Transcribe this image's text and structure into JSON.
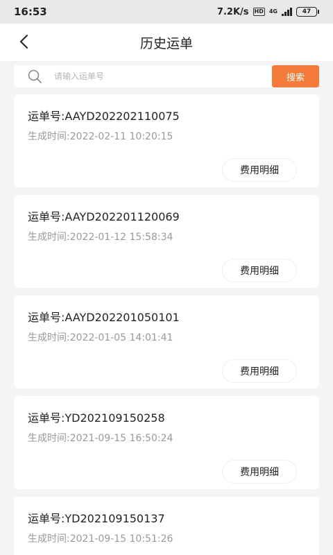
{
  "status_bar": {
    "time": "16:53",
    "network_speed": "7.2K/s",
    "hd_label": "HD",
    "network_type": "4G",
    "battery": "47"
  },
  "header": {
    "title": "历史运单",
    "back_icon": "chevron-left-icon"
  },
  "search": {
    "placeholder": "请输入运单号",
    "value": "",
    "button_label": "搜索",
    "icon": "search-icon"
  },
  "colors": {
    "accent": "#f47b3a",
    "background": "#f4f4f4",
    "card": "#ffffff",
    "secondary_text": "#999999"
  },
  "orders": [
    {
      "order_no": "运单号:AAYD202202110075",
      "created": "生成时间:2022-02-11 10:20:15",
      "fee_label": "费用明细"
    },
    {
      "order_no": "运单号:AAYD202201120069",
      "created": "生成时间:2022-01-12 15:58:34",
      "fee_label": "费用明细"
    },
    {
      "order_no": "运单号:AAYD202201050101",
      "created": "生成时间:2022-01-05 14:01:41",
      "fee_label": "费用明细"
    },
    {
      "order_no": "运单号:YD202109150258",
      "created": "生成时间:2021-09-15 16:50:24",
      "fee_label": "费用明细"
    },
    {
      "order_no": "运单号:YD202109150137",
      "created": "生成时间:2021-09-15 10:51:26",
      "fee_label": "费用明细"
    }
  ]
}
